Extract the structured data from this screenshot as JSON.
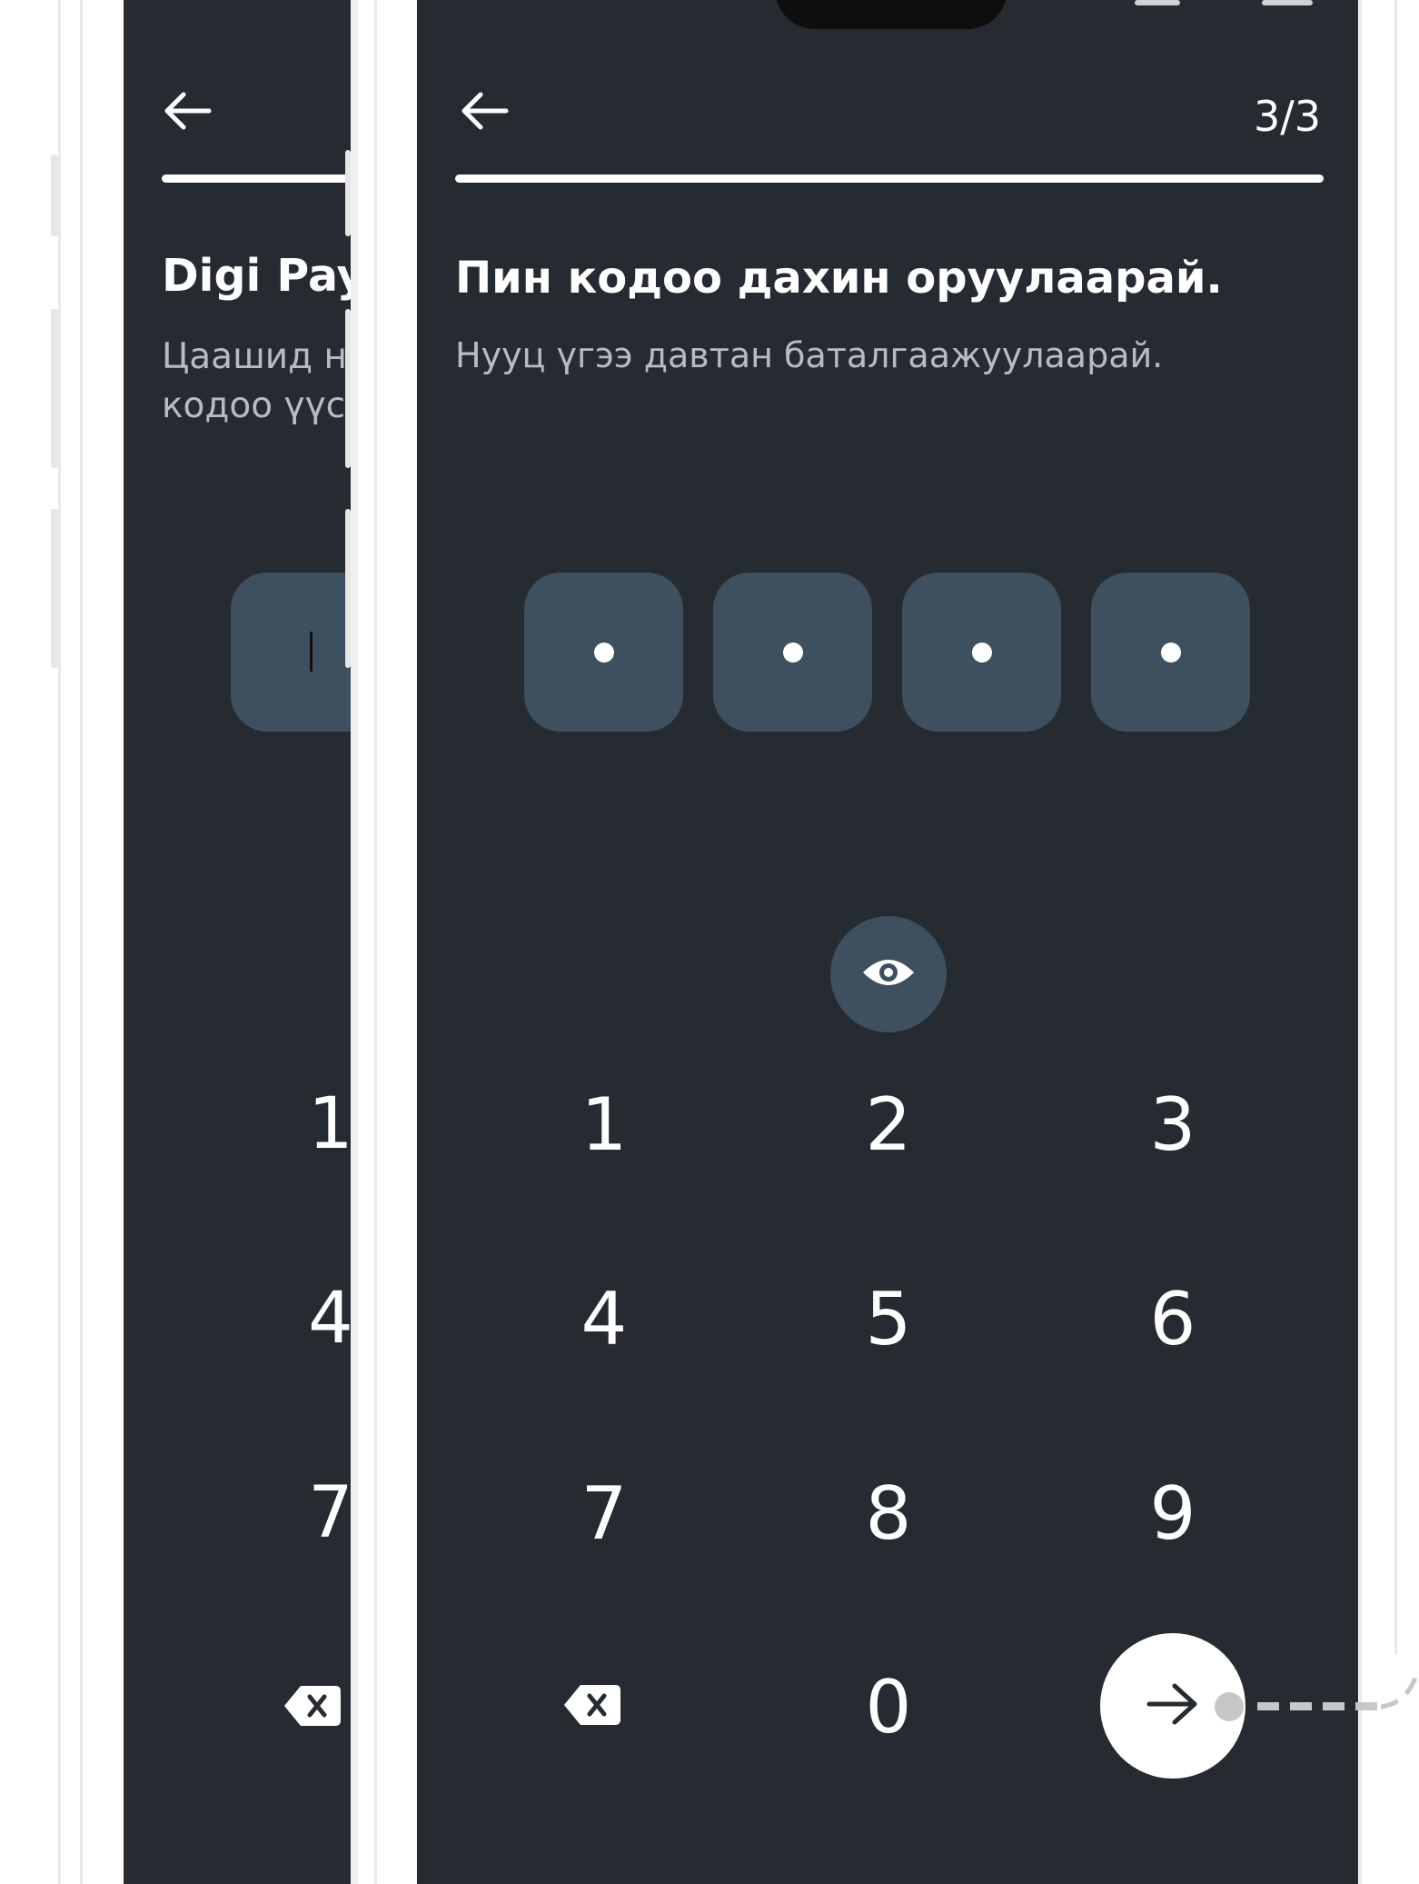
{
  "colors": {
    "screen_bg": "#262b31",
    "pin_box": "#3e4f5f",
    "text_primary": "#ffffff",
    "text_secondary": "#b7bcc3",
    "connector": "#c7c7c7"
  },
  "back_screen": {
    "title_visible": "Digi Pay-",
    "subtitle_line1": "Цаашид н",
    "subtitle_line2": "кодоо үүс",
    "keys_visible": [
      "1",
      "4",
      "7"
    ],
    "icons": [
      "arrow-left-icon",
      "backspace-icon"
    ]
  },
  "front_screen": {
    "step": "3/3",
    "progress_percent": 100,
    "title": "Пин кодоо дахин оруулаарай.",
    "subtitle": "Нууц үгээ давтан баталгаажуулаарай.",
    "pin_length": 4,
    "pin_filled": 4,
    "keypad": {
      "row1": [
        "1",
        "2",
        "3"
      ],
      "row2": [
        "4",
        "5",
        "6"
      ],
      "row3": [
        "7",
        "8",
        "9"
      ],
      "row4": [
        "0"
      ]
    },
    "icons": {
      "back": "arrow-left-icon",
      "visibility": "eye-icon",
      "delete": "backspace-icon",
      "next": "arrow-right-icon"
    }
  }
}
